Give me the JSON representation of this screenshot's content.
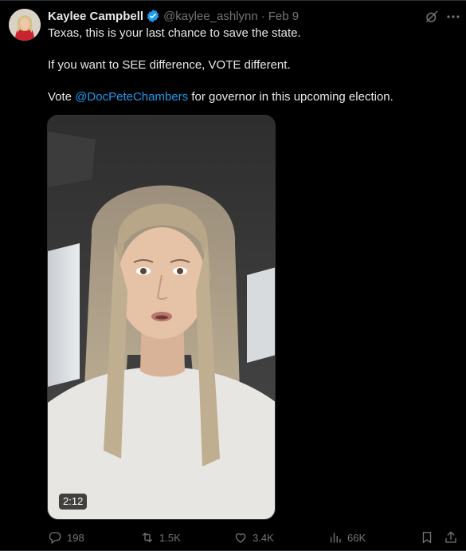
{
  "author": {
    "display_name": "Kaylee Campbell",
    "handle": "@kaylee_ashlynn",
    "date": "Feb 9",
    "separator": "·"
  },
  "tweet": {
    "line1": "Texas, this is your last chance to save the state.",
    "line2": "If you want to SEE difference, VOTE different.",
    "line3_prefix": "Vote ",
    "line3_mention": "@DocPeteChambers",
    "line3_suffix": " for governor in this upcoming election."
  },
  "media": {
    "duration": "2:12"
  },
  "actions": {
    "replies": "198",
    "reposts": "1.5K",
    "likes": "3.4K",
    "views": "66K"
  },
  "colors": {
    "background": "#000000",
    "text": "#e7e9ea",
    "muted": "#71767b",
    "accent": "#1d9bf0"
  },
  "icons": {
    "verified": "verified-badge-icon",
    "grok": "grok-icon",
    "more": "more-icon",
    "reply": "reply-icon",
    "repost": "repost-icon",
    "like": "heart-icon",
    "views": "views-icon",
    "bookmark": "bookmark-icon",
    "share": "share-icon"
  }
}
